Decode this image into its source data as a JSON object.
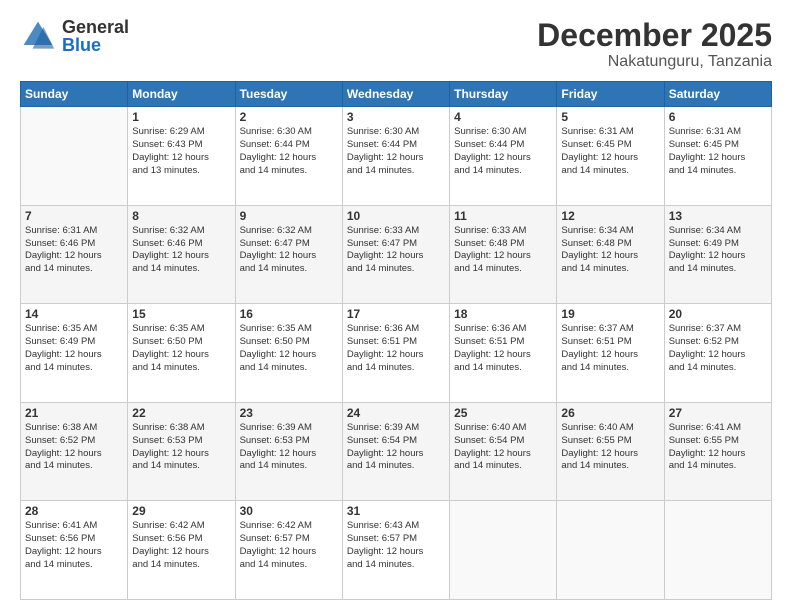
{
  "logo": {
    "general": "General",
    "blue": "Blue"
  },
  "header": {
    "month": "December 2025",
    "location": "Nakatunguru, Tanzania"
  },
  "weekdays": [
    "Sunday",
    "Monday",
    "Tuesday",
    "Wednesday",
    "Thursday",
    "Friday",
    "Saturday"
  ],
  "weeks": [
    [
      {
        "day": "",
        "info": ""
      },
      {
        "day": "1",
        "info": "Sunrise: 6:29 AM\nSunset: 6:43 PM\nDaylight: 12 hours\nand 13 minutes."
      },
      {
        "day": "2",
        "info": "Sunrise: 6:30 AM\nSunset: 6:44 PM\nDaylight: 12 hours\nand 14 minutes."
      },
      {
        "day": "3",
        "info": "Sunrise: 6:30 AM\nSunset: 6:44 PM\nDaylight: 12 hours\nand 14 minutes."
      },
      {
        "day": "4",
        "info": "Sunrise: 6:30 AM\nSunset: 6:44 PM\nDaylight: 12 hours\nand 14 minutes."
      },
      {
        "day": "5",
        "info": "Sunrise: 6:31 AM\nSunset: 6:45 PM\nDaylight: 12 hours\nand 14 minutes."
      },
      {
        "day": "6",
        "info": "Sunrise: 6:31 AM\nSunset: 6:45 PM\nDaylight: 12 hours\nand 14 minutes."
      }
    ],
    [
      {
        "day": "7",
        "info": "Sunrise: 6:31 AM\nSunset: 6:46 PM\nDaylight: 12 hours\nand 14 minutes."
      },
      {
        "day": "8",
        "info": "Sunrise: 6:32 AM\nSunset: 6:46 PM\nDaylight: 12 hours\nand 14 minutes."
      },
      {
        "day": "9",
        "info": "Sunrise: 6:32 AM\nSunset: 6:47 PM\nDaylight: 12 hours\nand 14 minutes."
      },
      {
        "day": "10",
        "info": "Sunrise: 6:33 AM\nSunset: 6:47 PM\nDaylight: 12 hours\nand 14 minutes."
      },
      {
        "day": "11",
        "info": "Sunrise: 6:33 AM\nSunset: 6:48 PM\nDaylight: 12 hours\nand 14 minutes."
      },
      {
        "day": "12",
        "info": "Sunrise: 6:34 AM\nSunset: 6:48 PM\nDaylight: 12 hours\nand 14 minutes."
      },
      {
        "day": "13",
        "info": "Sunrise: 6:34 AM\nSunset: 6:49 PM\nDaylight: 12 hours\nand 14 minutes."
      }
    ],
    [
      {
        "day": "14",
        "info": "Sunrise: 6:35 AM\nSunset: 6:49 PM\nDaylight: 12 hours\nand 14 minutes."
      },
      {
        "day": "15",
        "info": "Sunrise: 6:35 AM\nSunset: 6:50 PM\nDaylight: 12 hours\nand 14 minutes."
      },
      {
        "day": "16",
        "info": "Sunrise: 6:35 AM\nSunset: 6:50 PM\nDaylight: 12 hours\nand 14 minutes."
      },
      {
        "day": "17",
        "info": "Sunrise: 6:36 AM\nSunset: 6:51 PM\nDaylight: 12 hours\nand 14 minutes."
      },
      {
        "day": "18",
        "info": "Sunrise: 6:36 AM\nSunset: 6:51 PM\nDaylight: 12 hours\nand 14 minutes."
      },
      {
        "day": "19",
        "info": "Sunrise: 6:37 AM\nSunset: 6:51 PM\nDaylight: 12 hours\nand 14 minutes."
      },
      {
        "day": "20",
        "info": "Sunrise: 6:37 AM\nSunset: 6:52 PM\nDaylight: 12 hours\nand 14 minutes."
      }
    ],
    [
      {
        "day": "21",
        "info": "Sunrise: 6:38 AM\nSunset: 6:52 PM\nDaylight: 12 hours\nand 14 minutes."
      },
      {
        "day": "22",
        "info": "Sunrise: 6:38 AM\nSunset: 6:53 PM\nDaylight: 12 hours\nand 14 minutes."
      },
      {
        "day": "23",
        "info": "Sunrise: 6:39 AM\nSunset: 6:53 PM\nDaylight: 12 hours\nand 14 minutes."
      },
      {
        "day": "24",
        "info": "Sunrise: 6:39 AM\nSunset: 6:54 PM\nDaylight: 12 hours\nand 14 minutes."
      },
      {
        "day": "25",
        "info": "Sunrise: 6:40 AM\nSunset: 6:54 PM\nDaylight: 12 hours\nand 14 minutes."
      },
      {
        "day": "26",
        "info": "Sunrise: 6:40 AM\nSunset: 6:55 PM\nDaylight: 12 hours\nand 14 minutes."
      },
      {
        "day": "27",
        "info": "Sunrise: 6:41 AM\nSunset: 6:55 PM\nDaylight: 12 hours\nand 14 minutes."
      }
    ],
    [
      {
        "day": "28",
        "info": "Sunrise: 6:41 AM\nSunset: 6:56 PM\nDaylight: 12 hours\nand 14 minutes."
      },
      {
        "day": "29",
        "info": "Sunrise: 6:42 AM\nSunset: 6:56 PM\nDaylight: 12 hours\nand 14 minutes."
      },
      {
        "day": "30",
        "info": "Sunrise: 6:42 AM\nSunset: 6:57 PM\nDaylight: 12 hours\nand 14 minutes."
      },
      {
        "day": "31",
        "info": "Sunrise: 6:43 AM\nSunset: 6:57 PM\nDaylight: 12 hours\nand 14 minutes."
      },
      {
        "day": "",
        "info": ""
      },
      {
        "day": "",
        "info": ""
      },
      {
        "day": "",
        "info": ""
      }
    ]
  ]
}
